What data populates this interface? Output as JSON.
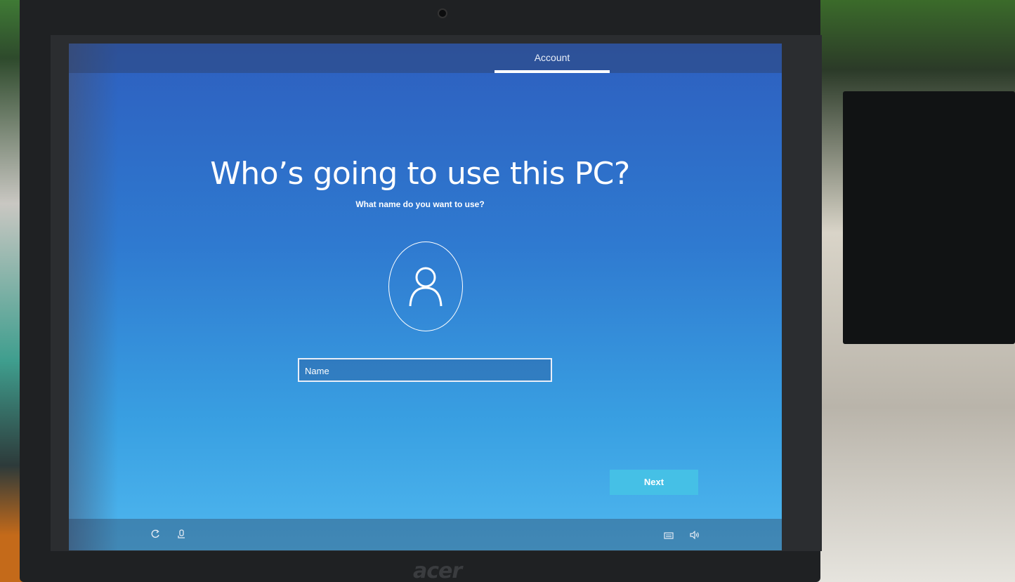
{
  "header": {
    "tab_label": "Account"
  },
  "main": {
    "title": "Who’s going to use this PC?",
    "subtitle": "What name do you want to use?",
    "name_placeholder": "Name",
    "next_label": "Next"
  },
  "footer": {
    "left_icons": [
      "accessibility-icon",
      "microphone-icon"
    ],
    "right_icons": [
      "keyboard-icon",
      "volume-icon"
    ]
  },
  "device": {
    "brand": "acer"
  },
  "colors": {
    "screen_top": "#2d5fbf",
    "screen_bottom": "#4fb7ef",
    "button": "#45c0e6"
  }
}
